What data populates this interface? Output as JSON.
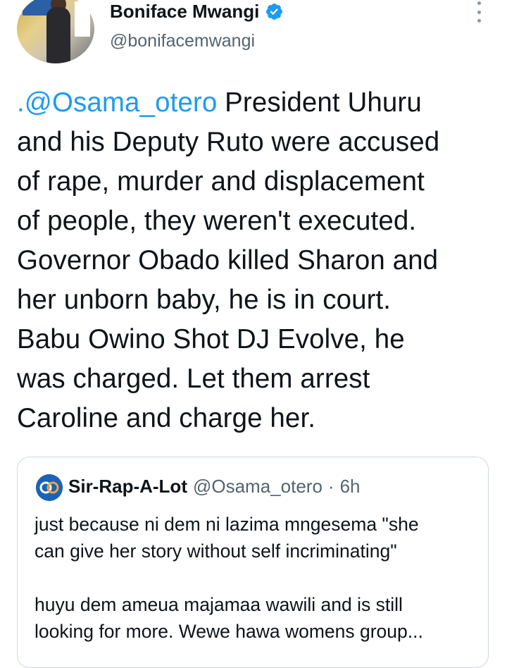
{
  "author": {
    "display_name": "Boniface Mwangi",
    "handle": "@bonifacemwangi",
    "verified": true,
    "avatar_icon": "profile-photo"
  },
  "tweet": {
    "mention": ".@Osama_otero",
    "lines": [
      " President Uhuru",
      "and his Deputy Ruto were accused",
      "of rape, murder and displacement",
      "of people, they weren't executed.",
      "Governor Obado killed Sharon and",
      "her unborn baby, he is in court.",
      "Babu Owino Shot DJ Evolve, he",
      "was charged. Let them arrest",
      "Caroline and charge her."
    ]
  },
  "quoted_tweet": {
    "display_name": "Sir-Rap-A-Lot",
    "handle": "@Osama_otero",
    "separator": "·",
    "time": "6h",
    "paragraph1": [
      "just because ni dem ni lazima mngesema \"she",
      "can give her story without self incriminating\""
    ],
    "paragraph2": [
      "huyu dem ameua majamaa wawili and is still",
      "looking for more. Wewe hawa womens group..."
    ]
  },
  "colors": {
    "link": "#1d9bf0",
    "text": "#0f1419",
    "secondary": "#536471",
    "border": "#cfd9de"
  }
}
